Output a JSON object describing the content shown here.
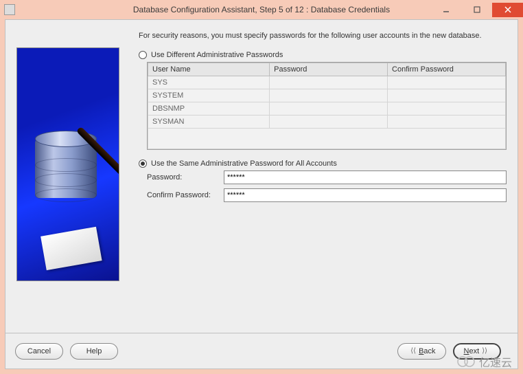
{
  "window": {
    "title": "Database Configuration Assistant, Step 5 of 12 : Database Credentials"
  },
  "main": {
    "instruction": "For security reasons, you must specify passwords for the following user accounts in the new database.",
    "opt_different": "Use Different Administrative Passwords",
    "opt_same": "Use the Same Administrative Password for All Accounts",
    "same_selected": true,
    "password_label": "Password:",
    "confirm_label": "Confirm Password:",
    "password_value": "******",
    "confirm_value": "******",
    "table": {
      "headers": [
        "User Name",
        "Password",
        "Confirm Password"
      ],
      "rows": [
        {
          "user": "SYS",
          "password": "",
          "confirm": ""
        },
        {
          "user": "SYSTEM",
          "password": "",
          "confirm": ""
        },
        {
          "user": "DBSNMP",
          "password": "",
          "confirm": ""
        },
        {
          "user": "SYSMAN",
          "password": "",
          "confirm": ""
        }
      ]
    }
  },
  "footer": {
    "cancel": "Cancel",
    "help": "Help",
    "back": "Back",
    "next": "Next"
  },
  "watermark": "亿速云"
}
